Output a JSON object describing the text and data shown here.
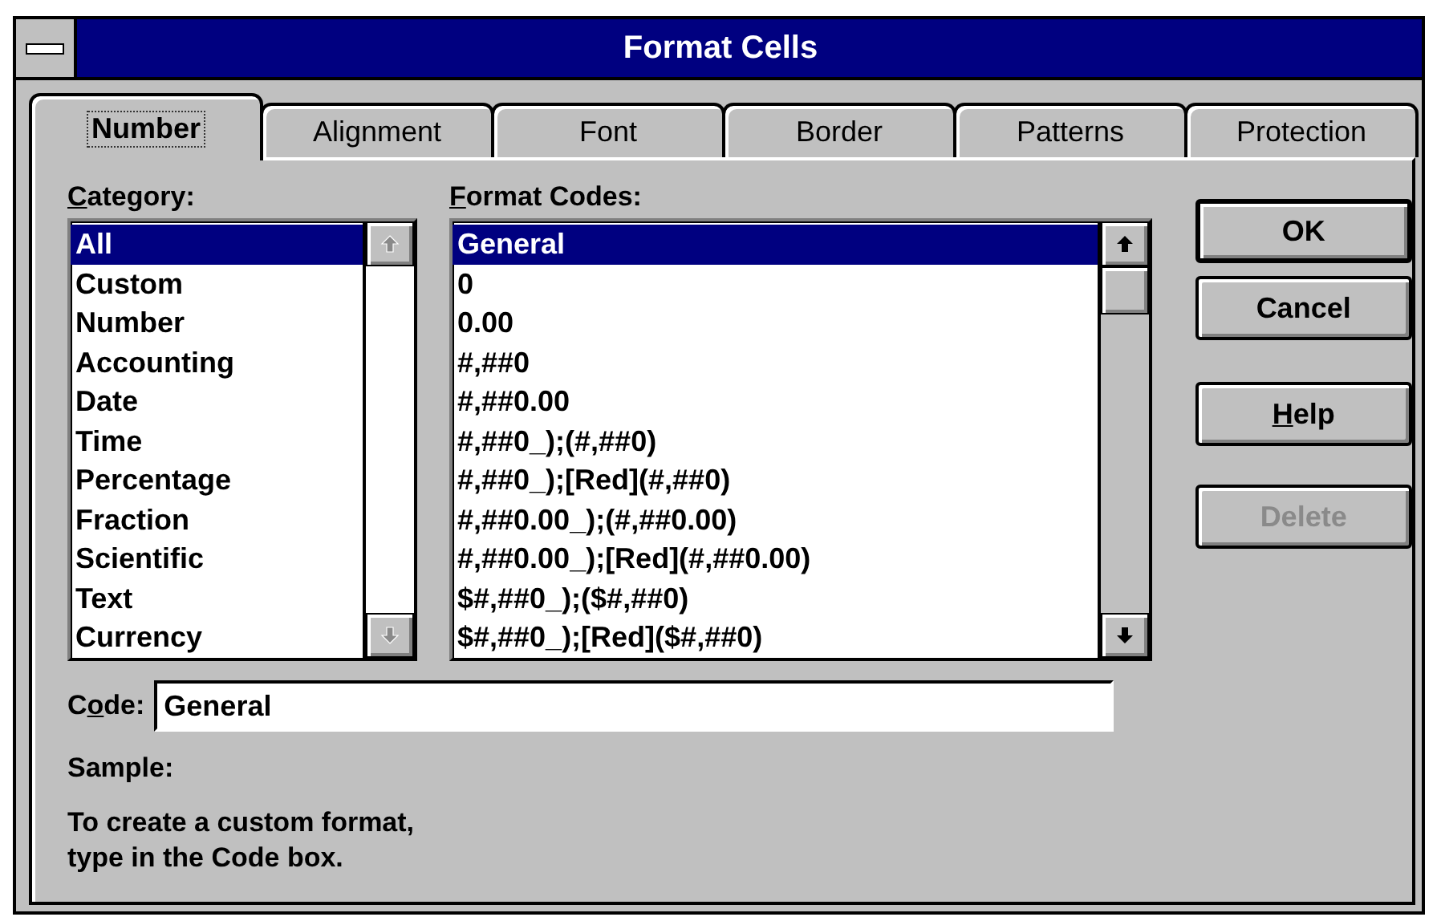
{
  "window": {
    "title": "Format Cells"
  },
  "tabs": [
    {
      "label": "Number",
      "selected": true
    },
    {
      "label": "Alignment",
      "selected": false
    },
    {
      "label": "Font",
      "selected": false
    },
    {
      "label": "Border",
      "selected": false
    },
    {
      "label": "Patterns",
      "selected": false
    },
    {
      "label": "Protection",
      "selected": false
    }
  ],
  "category": {
    "label": [
      {
        "text": "C",
        "underlined": true
      },
      {
        "text": "ategory:",
        "underlined": false
      }
    ],
    "items": [
      {
        "text": "All",
        "selected": true
      },
      {
        "text": "Custom",
        "selected": false
      },
      {
        "text": "Number",
        "selected": false
      },
      {
        "text": "Accounting",
        "selected": false
      },
      {
        "text": "Date",
        "selected": false
      },
      {
        "text": "Time",
        "selected": false
      },
      {
        "text": "Percentage",
        "selected": false
      },
      {
        "text": "Fraction",
        "selected": false
      },
      {
        "text": "Scientific",
        "selected": false
      },
      {
        "text": "Text",
        "selected": false
      },
      {
        "text": "Currency",
        "selected": false
      }
    ]
  },
  "format_codes": {
    "label": [
      {
        "text": "F",
        "underlined": true
      },
      {
        "text": "ormat Codes:",
        "underlined": false
      }
    ],
    "items": [
      {
        "text": "General",
        "selected": true
      },
      {
        "text": "0",
        "selected": false
      },
      {
        "text": "0.00",
        "selected": false
      },
      {
        "text": "#,##0",
        "selected": false
      },
      {
        "text": "#,##0.00",
        "selected": false
      },
      {
        "text": "#,##0_);(#,##0)",
        "selected": false
      },
      {
        "text": "#,##0_);[Red](#,##0)",
        "selected": false
      },
      {
        "text": "#,##0.00_);(#,##0.00)",
        "selected": false
      },
      {
        "text": "#,##0.00_);[Red](#,##0.00)",
        "selected": false
      },
      {
        "text": "$#,##0_);($#,##0)",
        "selected": false
      },
      {
        "text": "$#,##0_);[Red]($#,##0)",
        "selected": false
      }
    ]
  },
  "code": {
    "label": [
      {
        "text": "C",
        "underlined": false
      },
      {
        "text": "o",
        "underlined": true
      },
      {
        "text": "de:",
        "underlined": false
      }
    ],
    "value": "General"
  },
  "sample": {
    "label": "Sample:"
  },
  "hint": [
    "To create a custom format,",
    "type in the Code box."
  ],
  "buttons": [
    {
      "label": "OK",
      "default": true,
      "disabled": false
    },
    {
      "label": "Cancel",
      "default": false,
      "disabled": false
    },
    {
      "label": [
        {
          "text": "H",
          "underlined": true
        },
        {
          "text": "elp",
          "underlined": false
        }
      ],
      "default": false,
      "disabled": false
    },
    {
      "label": "Delete",
      "default": false,
      "disabled": true
    }
  ]
}
